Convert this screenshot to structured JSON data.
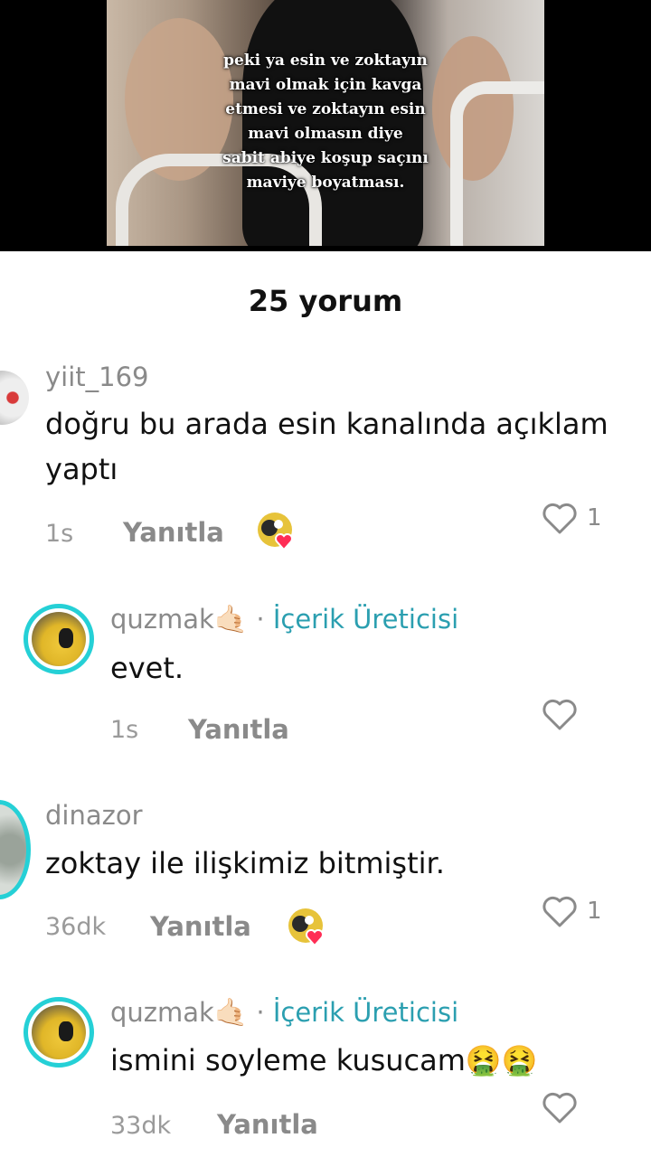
{
  "video": {
    "caption": "peki ya esin ve zoktayın\nmavi olmak için kavga\netmesi ve zoktayın esin\nmavi olmasın diye\nsabit abiye koşup saçını\nmaviye boyatması."
  },
  "comments_title": "25 yorum",
  "comments": [
    {
      "username": "yiit_169",
      "text_line1": "doğru bu arada esin kanalında açıklam",
      "text_line2": "yaptı",
      "time": "1s",
      "reply_label": "Yanıtla",
      "like_count": "1"
    },
    {
      "username": "quzmak",
      "badge_separator": "·",
      "creator_label": "İçerik Üreticisi",
      "text": "evet.",
      "time": "1s",
      "reply_label": "Yanıtla"
    },
    {
      "username": "dinazor",
      "text": "zoktay ile ilişkimiz bitmiştir.",
      "time": "36dk",
      "reply_label": "Yanıtla",
      "like_count": "1"
    },
    {
      "username": "quzmak",
      "badge_separator": "·",
      "creator_label": "İçerik Üreticisi",
      "text": "ismini soyleme kusucam🤮🤮",
      "time": "33dk",
      "reply_label": "Yanıtla"
    }
  ],
  "icons": {
    "like": "heart-outline-icon",
    "creator_liked": "creator-liked-badge-icon",
    "username_emoji": "hand-emoji"
  },
  "colors": {
    "creator_label": "#2b9fb0",
    "avatar_ring": "#25d0d6",
    "heart_badge": "#ff2d55"
  }
}
